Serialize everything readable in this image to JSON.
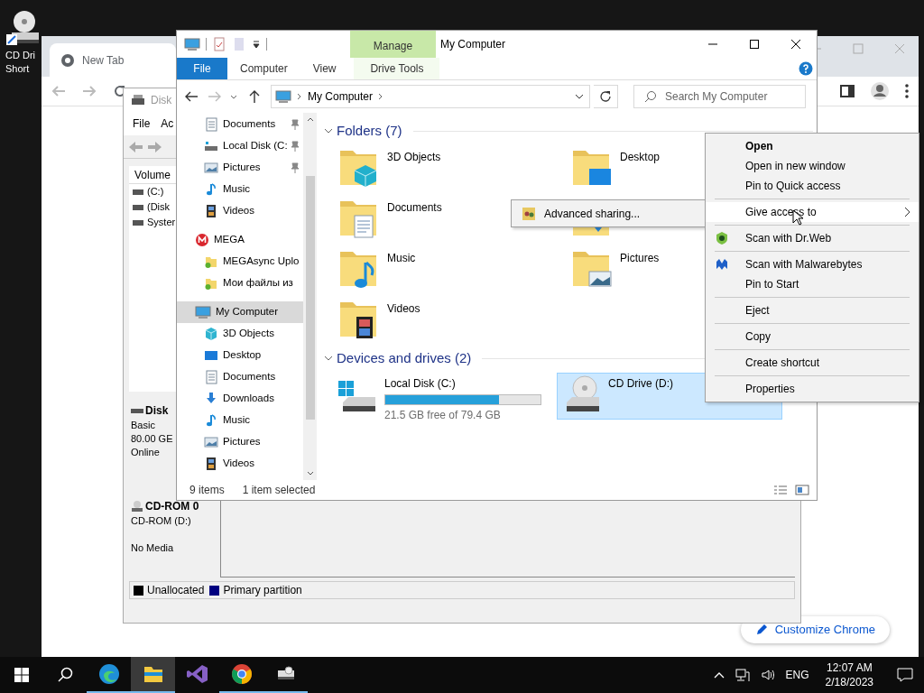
{
  "desktop_icon": {
    "label_lines": [
      "CD Dri",
      "Short"
    ]
  },
  "chrome": {
    "tab": "New Tab",
    "customize_button": "Customize Chrome"
  },
  "disk_management": {
    "title": "Disk",
    "menu": [
      "File",
      "Ac"
    ],
    "volume_header": "Volume",
    "volumes": [
      "(C:)",
      "(Disk",
      "Syster"
    ],
    "disks": [
      {
        "kind": "disk",
        "lines": [
          "Disk",
          "Basic",
          "80.00 GE",
          "Online"
        ]
      },
      {
        "kind": "cdrom",
        "lines": [
          "CD-ROM 0",
          "CD-ROM (D:)",
          "No Media"
        ]
      }
    ],
    "legend": [
      {
        "label": "Unallocated",
        "color": "#000000"
      },
      {
        "label": "Primary partition",
        "color": "#000080"
      }
    ]
  },
  "explorer": {
    "title": "My Computer",
    "context_tab": "Manage",
    "ribbon_tabs": [
      {
        "label": "File",
        "kind": "file"
      },
      {
        "label": "Computer",
        "kind": "tab"
      },
      {
        "label": "View",
        "kind": "tab"
      },
      {
        "label": "Drive Tools",
        "kind": "contextual"
      }
    ],
    "address": "My Computer",
    "search_placeholder": "Search My Computer",
    "quick_access": [
      {
        "label": "Documents",
        "kind": "documents",
        "pinned": true,
        "selected": false
      },
      {
        "label": "Local Disk (C:",
        "kind": "disk",
        "pinned": true,
        "selected": false
      },
      {
        "label": "Pictures",
        "kind": "pictures",
        "pinned": true,
        "selected": false
      },
      {
        "label": "Music",
        "kind": "music",
        "pinned": false,
        "selected": false
      },
      {
        "label": "Videos",
        "kind": "videos",
        "pinned": false,
        "selected": false
      }
    ],
    "tree": [
      {
        "label": "MEGA",
        "kind": "mega",
        "selected": false,
        "children": [
          {
            "label": "MEGAsync Uplo",
            "kind": "megafolder",
            "selected": false
          },
          {
            "label": "Мои файлы из",
            "kind": "megafolder",
            "selected": false
          }
        ]
      },
      {
        "label": "My Computer",
        "kind": "computer",
        "selected": true,
        "children": [
          {
            "label": "3D Objects",
            "kind": "objects",
            "selected": false
          },
          {
            "label": "Desktop",
            "kind": "desktop",
            "selected": false
          },
          {
            "label": "Documents",
            "kind": "documents",
            "selected": false
          },
          {
            "label": "Downloads",
            "kind": "downloads",
            "selected": false
          },
          {
            "label": "Music",
            "kind": "music",
            "selected": false
          },
          {
            "label": "Pictures",
            "kind": "pictures",
            "selected": false
          },
          {
            "label": "Videos",
            "kind": "videos",
            "selected": false
          }
        ]
      }
    ],
    "folders_header": "Folders (7)",
    "folders": [
      {
        "label": "3D Objects",
        "kind": "objects"
      },
      {
        "label": "Desktop",
        "kind": "desktop"
      },
      {
        "label": "Documents",
        "kind": "documents"
      },
      {
        "kind": "downloads"
      },
      {
        "label": "Music",
        "kind": "music"
      },
      {
        "label": "Pictures",
        "kind": "pictures"
      },
      {
        "label": "Videos",
        "kind": "videos"
      }
    ],
    "drives_header": "Devices and drives (2)",
    "drives": [
      {
        "label": "Local Disk (C:)",
        "kind": "hdd",
        "level": 0.73,
        "detail": "21.5 GB free of 79.4 GB",
        "selected": false
      },
      {
        "label": "CD Drive (D:)",
        "kind": "cd",
        "selected": true
      }
    ],
    "status": [
      "9 items",
      "1 item selected"
    ]
  },
  "context_menu": [
    {
      "label": "Open",
      "kind": "default",
      "separator_before": false,
      "highlighted": false
    },
    {
      "label": "Open in new window",
      "kind": "plain",
      "separator_before": false,
      "highlighted": false
    },
    {
      "label": "Pin to Quick access",
      "kind": "plain",
      "separator_before": false,
      "highlighted": false
    },
    {
      "label": "Give access to",
      "kind": "submenu",
      "separator_before": true,
      "highlighted": true
    },
    {
      "label": "Scan with Dr.Web",
      "kind": "drweb",
      "separator_before": true,
      "highlighted": false
    },
    {
      "label": "Scan with Malwarebytes",
      "kind": "malwarebytes",
      "separator_before": true,
      "highlighted": false
    },
    {
      "label": "Pin to Start",
      "kind": "plain",
      "separator_before": false,
      "highlighted": false
    },
    {
      "label": "Eject",
      "kind": "plain",
      "separator_before": true,
      "highlighted": false
    },
    {
      "label": "Copy",
      "kind": "plain",
      "separator_before": true,
      "highlighted": false
    },
    {
      "label": "Create shortcut",
      "kind": "plain",
      "separator_before": true,
      "highlighted": false
    },
    {
      "label": "Properties",
      "kind": "plain",
      "separator_before": true,
      "highlighted": false
    }
  ],
  "submenu": [
    {
      "label": "Advanced sharing..."
    }
  ],
  "taskbar": {
    "apps": [
      {
        "kind": "edge",
        "running": true,
        "selected": false
      },
      {
        "kind": "explorer",
        "running": true,
        "selected": true
      },
      {
        "kind": "vs",
        "running": false,
        "selected": false
      },
      {
        "kind": "chrome",
        "running": true,
        "selected": false
      },
      {
        "kind": "drive",
        "running": true,
        "selected": false
      }
    ],
    "language": "ENG",
    "time": "12:07 AM",
    "date": "2/18/2023"
  }
}
